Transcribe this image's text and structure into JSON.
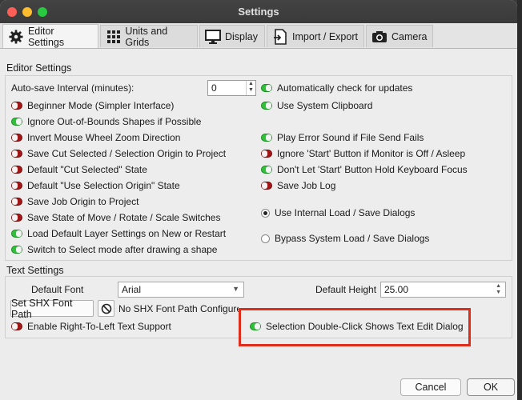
{
  "window": {
    "title": "Settings"
  },
  "tabs": [
    {
      "label": "Editor Settings",
      "icon": "gear-icon",
      "active": true
    },
    {
      "label": "Units and Grids",
      "icon": "grid-icon",
      "active": false
    },
    {
      "label": "Display",
      "icon": "monitor-icon",
      "active": false
    },
    {
      "label": "Import / Export",
      "icon": "import-export-icon",
      "active": false
    },
    {
      "label": "Camera",
      "icon": "camera-icon",
      "active": false
    }
  ],
  "editor": {
    "title": "Editor Settings",
    "autosave_label": "Auto-save Interval (minutes):",
    "autosave_value": "0",
    "left_items": [
      {
        "label": "Beginner Mode (Simpler Interface)",
        "on": false
      },
      {
        "label": "Ignore Out-of-Bounds Shapes if Possible",
        "on": true
      },
      {
        "label": "Invert Mouse Wheel Zoom Direction",
        "on": false
      },
      {
        "label": "Save Cut Selected / Selection Origin to Project",
        "on": false
      },
      {
        "label": "Default \"Cut Selected\" State",
        "on": false
      },
      {
        "label": "Default \"Use Selection Origin\" State",
        "on": false
      },
      {
        "label": "Save Job Origin to Project",
        "on": false
      },
      {
        "label": "Save State of Move / Rotate / Scale Switches",
        "on": false
      },
      {
        "label": "Load Default Layer Settings on New or Restart",
        "on": true
      },
      {
        "label": "Switch to Select mode after drawing a shape",
        "on": true
      }
    ],
    "right_top": [
      {
        "label": "Automatically check for updates",
        "on": true
      },
      {
        "label": "Use System Clipboard",
        "on": true
      }
    ],
    "right_mid": [
      {
        "label": "Play Error Sound if File Send Fails",
        "on": true
      },
      {
        "label": "Ignore 'Start' Button if Monitor is Off / Asleep",
        "on": false
      },
      {
        "label": "Don't Let 'Start' Button Hold Keyboard Focus",
        "on": true
      },
      {
        "label": "Save Job Log",
        "on": false
      }
    ],
    "radio_internal": "Use Internal Load / Save Dialogs",
    "radio_bypass": "Bypass System Load / Save Dialogs"
  },
  "text": {
    "title": "Text Settings",
    "default_font_label": "Default Font",
    "default_font_value": "Arial",
    "default_height_label": "Default Height",
    "default_height_value": "25.00",
    "shx_button": "Set SHX Font Path",
    "shx_status": "No SHX Font Path Configured",
    "rtl_label": "Enable Right-To-Left Text Support",
    "rtl_on": false,
    "dblclick_label": "Selection Double-Click Shows Text Edit Dialog",
    "dblclick_on": true
  },
  "footer": {
    "cancel": "Cancel",
    "ok": "OK"
  },
  "colors": {
    "toggle_on": "#2fc13a",
    "toggle_off": "#a31616",
    "highlight": "#de2d1b",
    "titlebar": "#3d3d3d"
  }
}
